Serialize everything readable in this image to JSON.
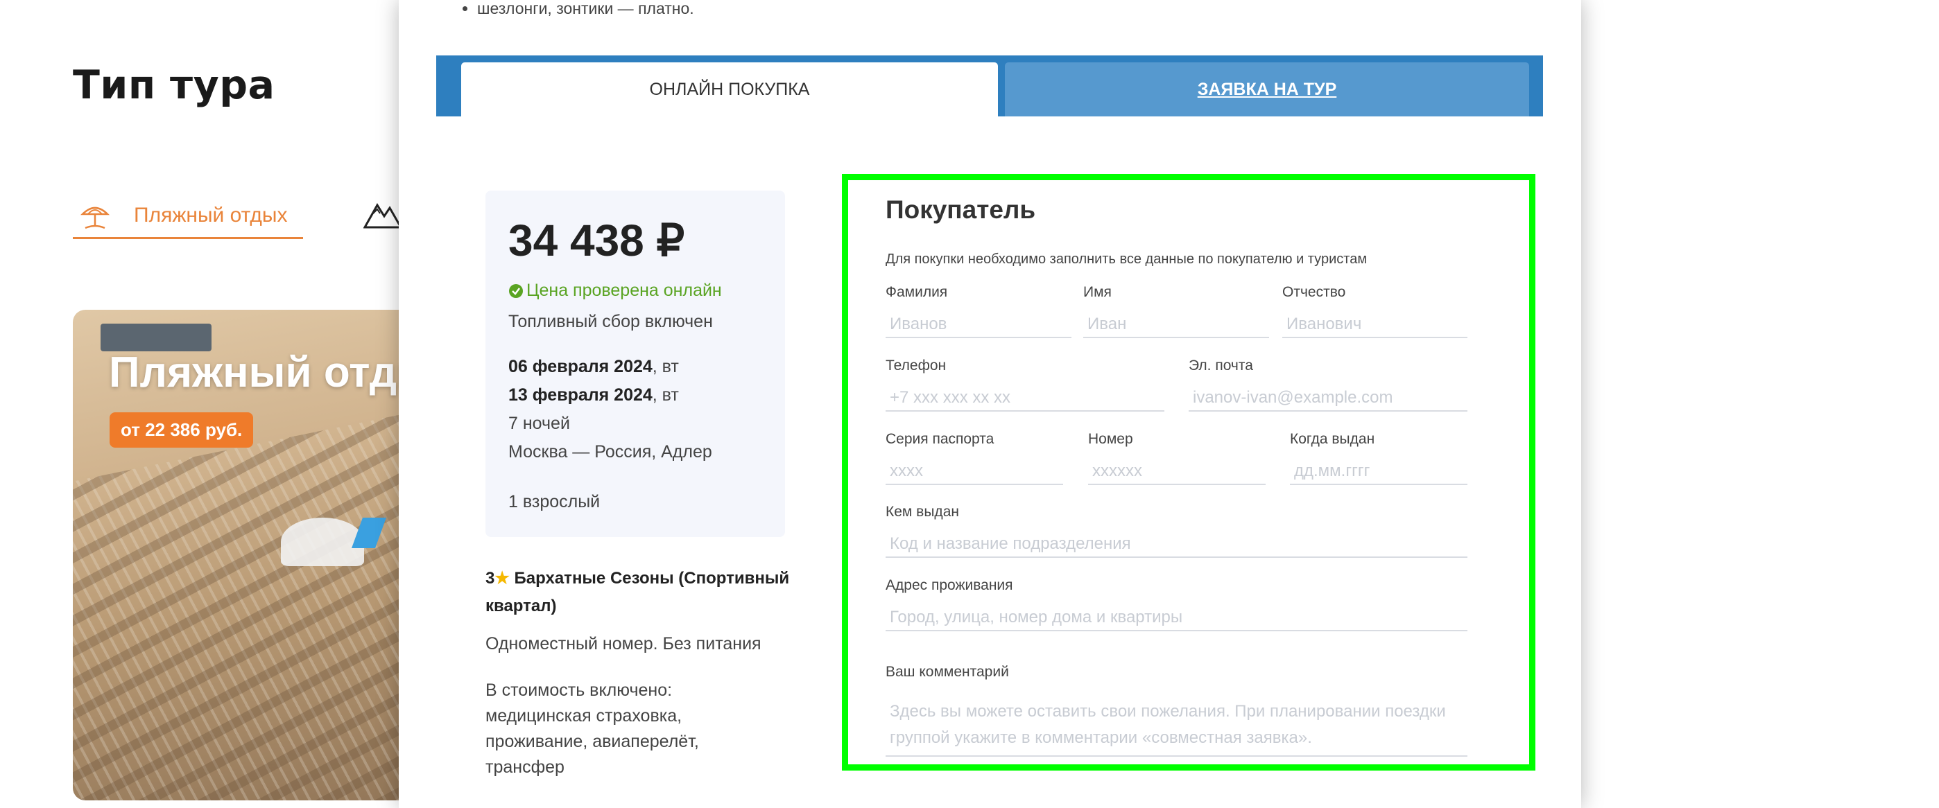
{
  "page": {
    "title": "Тип тура",
    "tour_tabs": [
      {
        "label": "Пляжный отдых",
        "icon": "beach-umbrella-icon",
        "active": true
      },
      {
        "label": "",
        "icon": "mountain-icon",
        "active": false
      }
    ],
    "promo": {
      "title": "Пляжный отдых",
      "price": "от 22 386 руб."
    },
    "accent_color": "#e9843a"
  },
  "modal": {
    "bullet": "шезлонги, зонтики — платно.",
    "tabs": [
      {
        "label": "ОНЛАЙН ПОКУПКА",
        "active": true
      },
      {
        "label": "ЗАЯВКА НА ТУР",
        "active": false
      }
    ],
    "summary": {
      "price": "34 438 ₽",
      "verified": "Цена проверена онлайн",
      "fuel": "Топливный сбор включен",
      "date_from": "06 февраля 2024",
      "date_from_day": ", вт",
      "date_to": "13 февраля 2024",
      "date_to_day": ", вт",
      "nights": "7 ночей",
      "route": "Москва — Россия, Адлер",
      "travellers": "1 взрослый"
    },
    "hotel": {
      "stars": "3",
      "name": "Бархатные Сезоны (Спортивный квартал)"
    },
    "room": "Одноместный номер. Без питания",
    "included": "В стоимость включено: медицинская страховка, проживание, авиаперелёт, трансфер",
    "form": {
      "title": "Покупатель",
      "note": "Для покупки необходимо заполнить все данные по покупателю и туристам",
      "last_name": {
        "label": "Фамилия",
        "placeholder": "Иванов"
      },
      "first_name": {
        "label": "Имя",
        "placeholder": "Иван"
      },
      "middle_name": {
        "label": "Отчество",
        "placeholder": "Иванович"
      },
      "phone": {
        "label": "Телефон",
        "placeholder": "+7 xxx xxx xx xx"
      },
      "email": {
        "label": "Эл. почта",
        "placeholder": "ivanov-ivan@example.com"
      },
      "passport_series": {
        "label": "Серия паспорта",
        "placeholder": "xxxx"
      },
      "passport_number": {
        "label": "Номер",
        "placeholder": "xxxxxx"
      },
      "issue_date": {
        "label": "Когда выдан",
        "placeholder": "дд.мм.гггг"
      },
      "issued_by": {
        "label": "Кем выдан",
        "placeholder": "Код и название подразделения"
      },
      "address": {
        "label": "Адрес проживания",
        "placeholder": "Город, улица, номер дома и квартиры"
      },
      "comment": {
        "label": "Ваш комментарий",
        "placeholder": "Здесь вы можете оставить свои пожелания. При планировании поездки группой укажите в комментарии «совместная заявка»."
      }
    }
  }
}
